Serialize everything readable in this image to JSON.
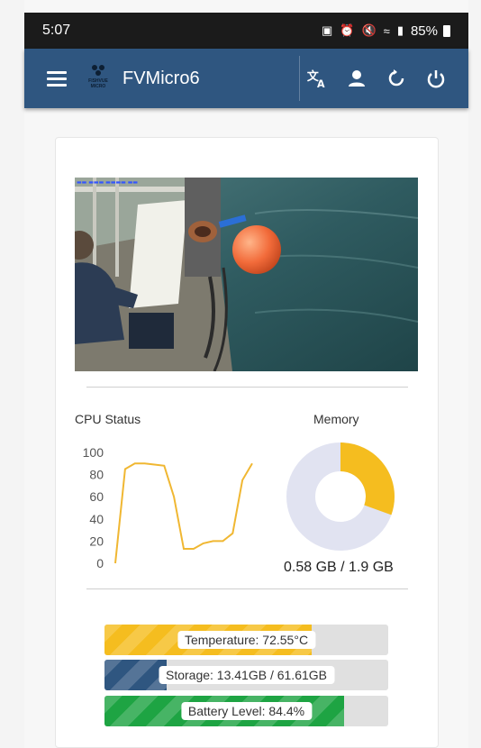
{
  "status_bar": {
    "time": "5:07",
    "battery": "85%"
  },
  "app_bar": {
    "title": "FVMicro6",
    "logo_text": "FISHVUE MICRO"
  },
  "cpu": {
    "title": "CPU Status",
    "y_ticks": [
      "100",
      "80",
      "60",
      "40",
      "20",
      "0"
    ]
  },
  "memory": {
    "title": "Memory",
    "value_text": "0.58 GB / 1.9 GB",
    "used_fraction": 0.305
  },
  "bars": {
    "temperature": {
      "label": "Temperature: 72.55°C",
      "fraction": 0.73,
      "color": "#f5bd1f"
    },
    "storage": {
      "label": "Storage: 13.41GB / 61.61GB",
      "fraction": 0.218,
      "color": "#2f5680"
    },
    "battery": {
      "label": "Battery Level: 84.4%",
      "fraction": 0.844,
      "color": "#1ea443"
    }
  },
  "chart_data": {
    "type": "line",
    "title": "CPU Status",
    "ylim": [
      0,
      100
    ],
    "y_ticks": [
      0,
      20,
      40,
      60,
      80,
      100
    ],
    "grid": false,
    "series": [
      {
        "values": [
          0,
          85,
          90,
          90,
          89,
          88,
          60,
          13,
          13,
          18,
          20,
          20,
          27,
          75,
          90
        ],
        "color": "#f0b732"
      }
    ]
  },
  "colors": {
    "app_bar": "#2f5680",
    "memory_used": "#f5bd1f",
    "memory_free": "#e1e3f1"
  }
}
